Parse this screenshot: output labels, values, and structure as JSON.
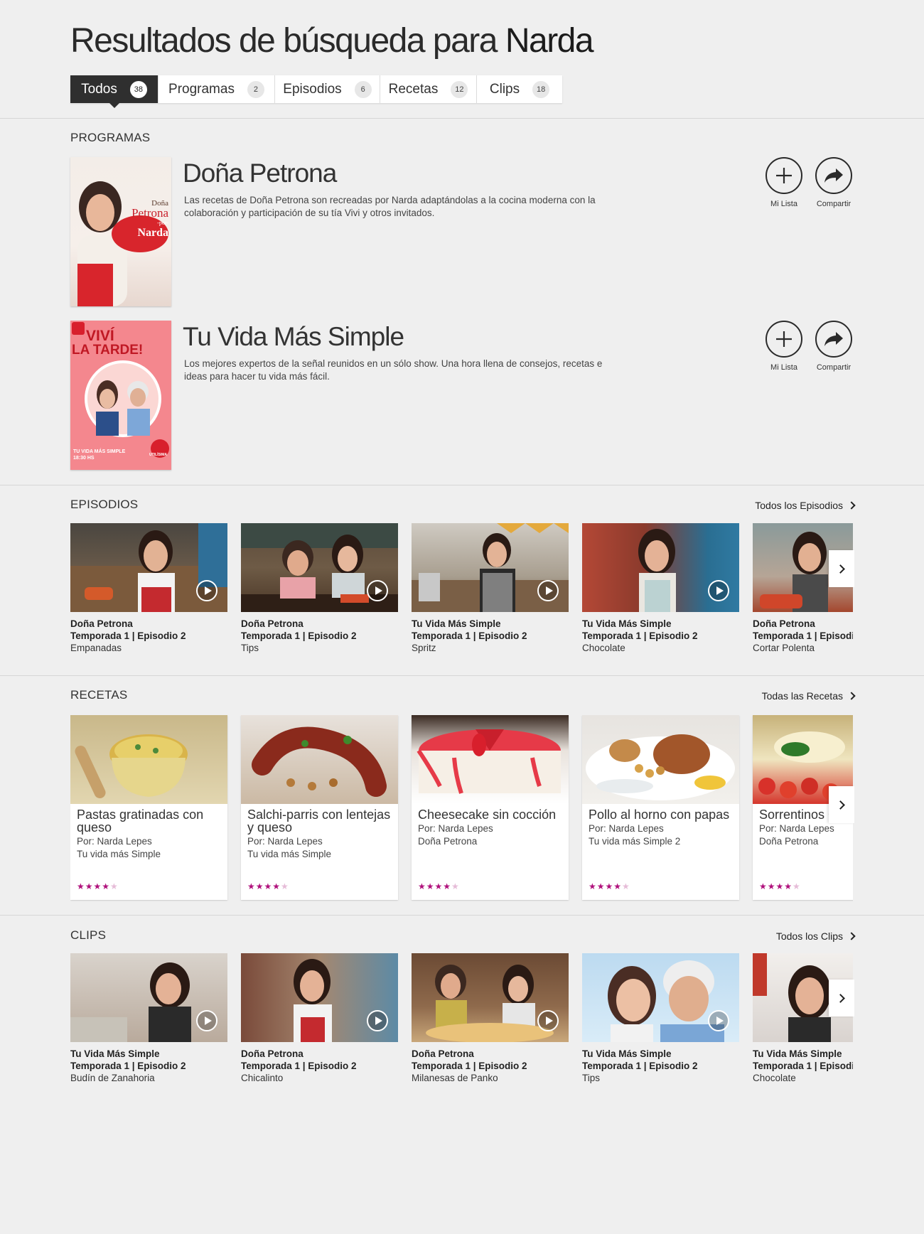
{
  "header": {
    "title_prefix": "Resultados de búsqueda para",
    "query": "Narda"
  },
  "tabs": [
    {
      "label": "Todos",
      "count": "38"
    },
    {
      "label": "Programas",
      "count": "2"
    },
    {
      "label": "Episodios",
      "count": "6"
    },
    {
      "label": "Recetas",
      "count": "12"
    },
    {
      "label": "Clips",
      "count": "18"
    }
  ],
  "programs": {
    "section_title": "PROGRAMAS",
    "items": [
      {
        "name": "Doña Petrona",
        "description": "Las recetas de Doña Petrona son recreadas por Narda adaptándolas a la cocina moderna con la colaboración y participación de su tía Vivi y otros invitados.",
        "poster_text": [
          "Doña",
          "Petrona",
          "-por-",
          "Narda"
        ]
      },
      {
        "name": "Tu Vida Más Simple",
        "description": "Los mejores expertos de la señal reunidos en un sólo show. Una hora llena de consejos, recetas e ideas para hacer tu vida más fácil.",
        "poster_text": [
          "VIVÍ",
          "LA TARDE!",
          "TU VIDA MÁS SIMPLE",
          "18:30 HS",
          "UTILÍSIMA"
        ]
      }
    ],
    "actions": {
      "add_label": "Mi Lista",
      "share_label": "Compartir"
    }
  },
  "episodes": {
    "section_title": "EPISODIOS",
    "see_all": "Todos los Episodios",
    "items": [
      {
        "show": "Doña Petrona",
        "season": "Temporada 1 | Episodio 2",
        "title": "Empanadas"
      },
      {
        "show": "Doña Petrona",
        "season": "Temporada 1 | Episodio 2",
        "title": "Tips"
      },
      {
        "show": "Tu Vida Más Simple",
        "season": "Temporada 1 | Episodio 2",
        "title": "Spritz"
      },
      {
        "show": "Tu Vida Más Simple",
        "season": "Temporada 1 | Episodio 2",
        "title": "Chocolate"
      },
      {
        "show": "Doña Petrona",
        "season": "Temporada 1 | Episodi",
        "title": "Cortar Polenta"
      }
    ]
  },
  "recipes": {
    "section_title": "RECETAS",
    "see_all": "Todas las Recetas",
    "items": [
      {
        "title": "Pastas gratinadas con queso",
        "author": "Por: Narda Lepes",
        "show": "Tu vida más Simple",
        "rating": 4
      },
      {
        "title": "Salchi-parris con lentejas y queso",
        "author": "Por: Narda Lepes",
        "show": "Tu vida más Simple",
        "rating": 4
      },
      {
        "title": "Cheesecake sin cocción",
        "author": "Por: Narda Lepes",
        "show": "Doña Petrona",
        "rating": 4
      },
      {
        "title": "Pollo al horno con papas",
        "author": "Por: Narda Lepes",
        "show": "Tu vida más Simple 2",
        "rating": 4
      },
      {
        "title": "Sorrentinos Capresse",
        "author": "Por: Narda Lepes",
        "show": "Doña Petrona",
        "rating": 4
      }
    ]
  },
  "clips": {
    "section_title": "CLIPS",
    "see_all": "Todos los Clips",
    "items": [
      {
        "show": "Tu Vida Más Simple",
        "season": "Temporada 1 | Episodio 2",
        "title": "Budín de Zanahoria"
      },
      {
        "show": "Doña Petrona",
        "season": "Temporada 1 | Episodio 2",
        "title": "Chicalinto"
      },
      {
        "show": "Doña Petrona",
        "season": "Temporada 1 | Episodio 2",
        "title": "Milanesas de Panko"
      },
      {
        "show": "Tu Vida Más Simple",
        "season": "Temporada 1 | Episodio 2",
        "title": "Tips"
      },
      {
        "show": "Tu Vida Más Simple",
        "season": "Temporada 1 | Episodi",
        "title": "Chocolate"
      }
    ]
  },
  "colors": {
    "accent_star": "#b0117c",
    "tab_active": "#2f2f2f",
    "background": "#efefef"
  }
}
